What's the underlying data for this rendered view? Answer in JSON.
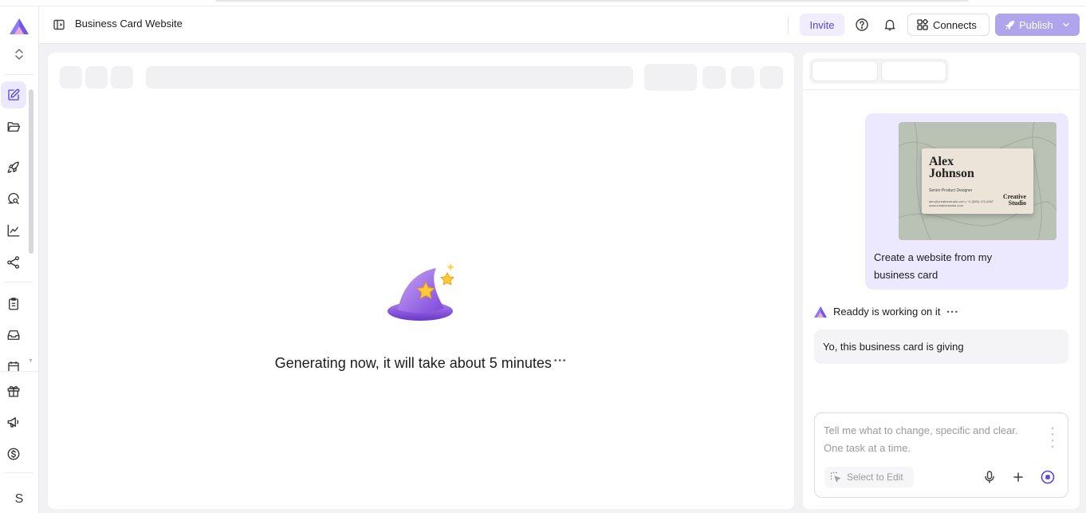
{
  "header": {
    "project_title": "Business Card Website",
    "invite_label": "Invite",
    "connects_label": "Connects",
    "publish_label": "Publish"
  },
  "sidebar": {
    "avatar_initial": "S",
    "items": [
      "edit-icon",
      "folder-icon",
      "rocket-icon",
      "search-chat-icon",
      "chart-icon",
      "share-icon",
      "clipboard-icon",
      "inbox-icon",
      "calendar-icon",
      "gift-icon",
      "megaphone-icon",
      "dollar-icon"
    ]
  },
  "preview": {
    "status_text": "Generating now, it will take about 5 minutes"
  },
  "chat": {
    "attachment": {
      "name": "Alex\nJohnson",
      "role": "Senior Product Designer",
      "contact": "alex@creativestudio.com | +1 (555) 123-4567\nwww.creativestudio.com",
      "company": "Creative\nStudio"
    },
    "user_message": "Create a website from my business card",
    "assistant_status": "Readdy is working on it",
    "assistant_message": "Yo, this business card is giving",
    "composer_placeholder": "Tell me what to change, specific and clear. One task at a time.",
    "select_to_edit_label": "Select to Edit"
  },
  "colors": {
    "accent": "#5b45d6",
    "accent_soft": "#ece8fd",
    "publish_disabled": "#b0a4ec"
  }
}
